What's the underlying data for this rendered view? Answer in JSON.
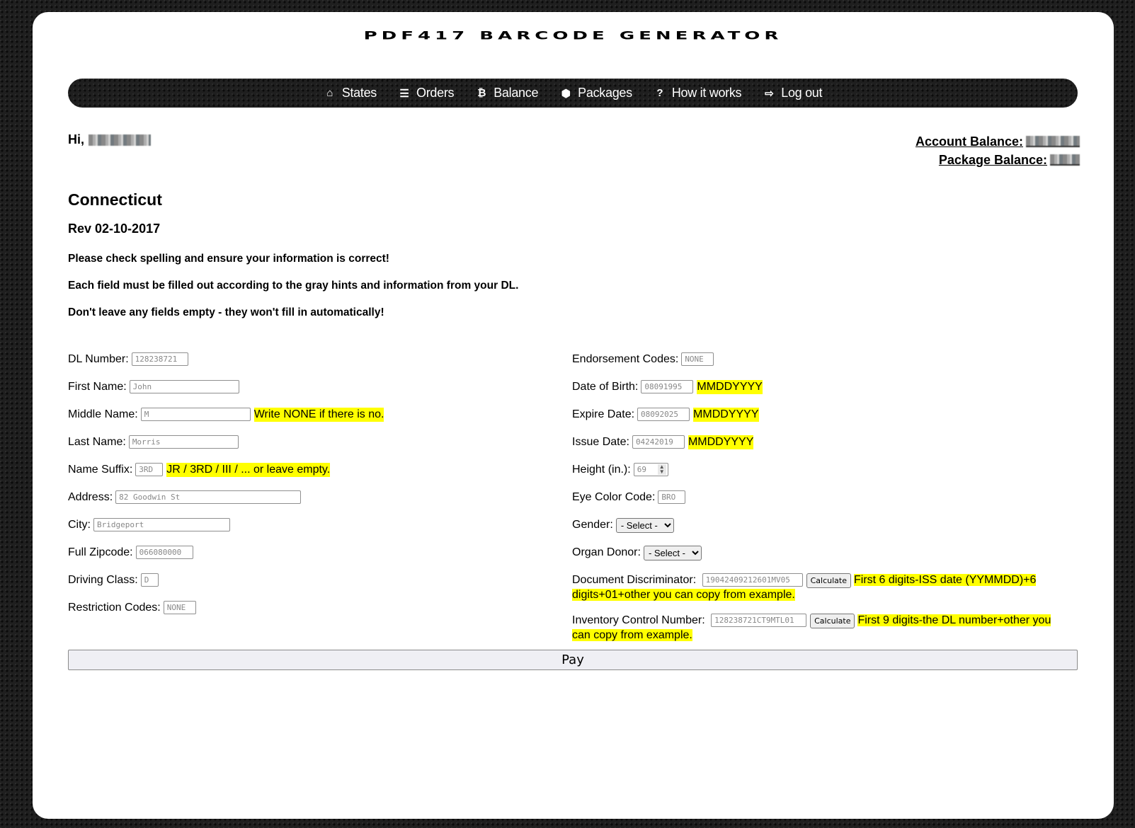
{
  "header": {
    "logo_text": "PDF417 Barcode Generator"
  },
  "nav": {
    "items": [
      {
        "label": "States",
        "icon": "home-icon",
        "glyph": "⌂"
      },
      {
        "label": "Orders",
        "icon": "list-icon",
        "glyph": "☰"
      },
      {
        "label": "Balance",
        "icon": "bitcoin-icon",
        "glyph": "₿"
      },
      {
        "label": "Packages",
        "icon": "cube-icon",
        "glyph": "⬢"
      },
      {
        "label": "How it works",
        "icon": "question-icon",
        "glyph": "?"
      },
      {
        "label": "Log out",
        "icon": "sign-out-icon",
        "glyph": "⇨"
      }
    ]
  },
  "user": {
    "greeting": "Hi,",
    "account_balance_label": "Account Balance:",
    "package_balance_label": "Package Balance:"
  },
  "form_header": {
    "state": "Connecticut",
    "revision": "Rev 02-10-2017",
    "notices": [
      "Please check spelling and ensure your information is correct!",
      "Each field must be filled out according to the gray hints and information from your DL.",
      "Don't leave any fields empty - they won't fill in automatically!"
    ]
  },
  "left_fields": {
    "dl_number": {
      "label": "DL Number:",
      "placeholder": "128238721"
    },
    "first_name": {
      "label": "First Name:",
      "placeholder": "John"
    },
    "middle_name": {
      "label": "Middle Name:",
      "placeholder": "M",
      "hint": "Write NONE if there is no."
    },
    "last_name": {
      "label": "Last Name:",
      "placeholder": "Morris"
    },
    "name_suffix": {
      "label": "Name Suffix:",
      "placeholder": "3RD",
      "hint": "JR / 3RD / III / ... or leave empty."
    },
    "address": {
      "label": "Address:",
      "placeholder": "82 Goodwin St"
    },
    "city": {
      "label": "City:",
      "placeholder": "Bridgeport"
    },
    "zipcode": {
      "label": "Full Zipcode:",
      "placeholder": "066080000"
    },
    "driving_class": {
      "label": "Driving Class:",
      "placeholder": "D"
    },
    "restriction_codes": {
      "label": "Restriction Codes:",
      "placeholder": "NONE"
    }
  },
  "right_fields": {
    "endorsement_codes": {
      "label": "Endorsement Codes:",
      "placeholder": "NONE"
    },
    "dob": {
      "label": "Date of Birth:",
      "placeholder": "08091995",
      "hint": "MMDDYYYY"
    },
    "expire_date": {
      "label": "Expire Date:",
      "placeholder": "08092025",
      "hint": "MMDDYYYY"
    },
    "issue_date": {
      "label": "Issue Date:",
      "placeholder": "04242019",
      "hint": "MMDDYYYY"
    },
    "height": {
      "label": "Height (in.):",
      "placeholder": "69"
    },
    "eye_color": {
      "label": "Eye Color Code:",
      "placeholder": "BRO"
    },
    "gender": {
      "label": "Gender:",
      "selected": "- Select -"
    },
    "organ_donor": {
      "label": "Organ Donor:",
      "selected": "- Select -"
    },
    "document_discriminator": {
      "label": "Document Discriminator:",
      "placeholder": "19042409212601MV05",
      "button": "Calculate",
      "hint": "First 6 digits-ISS date (YYMMDD)+6 digits+01+other you can copy from example."
    },
    "inventory_control": {
      "label": "Inventory Control Number:",
      "placeholder": "128238721CT9MTL01",
      "button": "Calculate",
      "hint": "First 9 digits-the DL number+other you can copy from example."
    }
  },
  "actions": {
    "pay_label": "Pay"
  },
  "colors": {
    "hint_highlight": "#ffff00",
    "nav_background": "#1f1f1f",
    "page_background": "#ffffff"
  }
}
